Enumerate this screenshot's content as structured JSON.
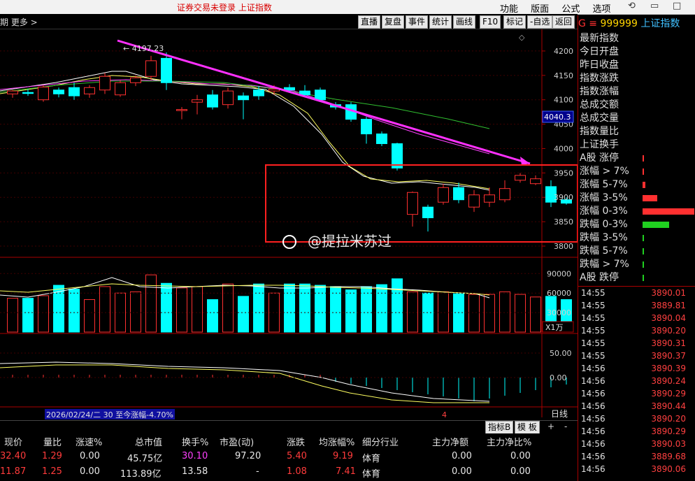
{
  "topbar": {
    "title": "证券交易未登录  上证指数",
    "menu": [
      "功能",
      "版面",
      "公式",
      "选项"
    ]
  },
  "toolbar": {
    "left": "期  更多 >",
    "buttons": [
      "直播",
      "复盘",
      "事件",
      "统计",
      "画线",
      "F10",
      "标记",
      "-自选",
      "返回"
    ]
  },
  "chart_data": {
    "type": "candlestick",
    "y_axis": [
      "4200",
      "4150",
      "4100",
      "4050",
      "4000",
      "3950",
      "3900",
      "3850",
      "3800"
    ],
    "ylim": [
      3800,
      4230
    ],
    "current_price_tag": "4040.3",
    "high_annotation": "← 4197.23",
    "date_range_label": "2026/02/24/二 30 至今涨幅-4.70%",
    "x_tick": "4",
    "vol_axis": [
      "90000",
      "60000",
      "30000"
    ],
    "vol_unit": "X1万",
    "macd_axis": [
      "50.00",
      "0.00"
    ],
    "period_label": "日线",
    "candles": [
      [
        4112,
        4118,
        4104,
        4120
      ],
      [
        4115,
        4114,
        4108,
        4122
      ],
      [
        4100,
        4126,
        4096,
        4130
      ],
      [
        4120,
        4112,
        4105,
        4125
      ],
      [
        4125,
        4108,
        4100,
        4135
      ],
      [
        4112,
        4125,
        4104,
        4130
      ],
      [
        4120,
        4148,
        4112,
        4155
      ],
      [
        4110,
        4135,
        4106,
        4140
      ],
      [
        4135,
        4145,
        4128,
        4150
      ],
      [
        4148,
        4180,
        4140,
        4190
      ],
      [
        4185,
        4135,
        4120,
        4197
      ],
      [
        4080,
        4080,
        4060,
        4085
      ],
      [
        4095,
        4100,
        4070,
        4110
      ],
      [
        4110,
        4085,
        4080,
        4120
      ],
      [
        4090,
        4118,
        4082,
        4125
      ],
      [
        4108,
        4100,
        4060,
        4115
      ],
      [
        4120,
        4108,
        4100,
        4128
      ],
      [
        4118,
        4122,
        4110,
        4130
      ],
      [
        4125,
        4120,
        4115,
        4132
      ],
      [
        4118,
        4110,
        4105,
        4130
      ],
      [
        4120,
        4100,
        4098,
        4125
      ],
      [
        4090,
        4085,
        4080,
        4095
      ],
      [
        4090,
        4060,
        4055,
        4095
      ],
      [
        4060,
        4030,
        4010,
        4065
      ],
      [
        4030,
        4010,
        4005,
        4035
      ],
      [
        4010,
        3960,
        3955,
        4012
      ],
      [
        3865,
        3910,
        3840,
        3912
      ],
      [
        3880,
        3858,
        3830,
        3885
      ],
      [
        3890,
        3920,
        3885,
        3928
      ],
      [
        3920,
        3895,
        3888,
        3930
      ],
      [
        3880,
        3905,
        3870,
        3915
      ],
      [
        3890,
        3905,
        3880,
        3920
      ],
      [
        3895,
        3918,
        3890,
        3935
      ],
      [
        3935,
        3945,
        3930,
        3950
      ],
      [
        3928,
        3938,
        3925,
        3945
      ],
      [
        3922,
        3890,
        3880,
        3935
      ],
      [
        3895,
        3888,
        3885,
        3900
      ]
    ],
    "volume": [
      52,
      52,
      56,
      72,
      66,
      50,
      70,
      60,
      62,
      88,
      75,
      68,
      70,
      50,
      74,
      55,
      74,
      60,
      74,
      74,
      72,
      70,
      65,
      70,
      73,
      82,
      62,
      60,
      62,
      59,
      58,
      58,
      62,
      58,
      54,
      55,
      50
    ]
  },
  "right_panel": {
    "code": "999999",
    "name": "上证指数",
    "prefix": "G ≡",
    "labels": [
      "最新指数",
      "今日开盘",
      "昨日收盘",
      "指数涨跌",
      "指数涨幅",
      "总成交额",
      "总成交量",
      "指数量比",
      "上证换手"
    ],
    "dist_labels": [
      "A股 涨停",
      "涨幅 > 7%",
      "涨幅 5-7%",
      "涨幅 3-5%",
      "涨幅 0-3%",
      "跌幅 0-3%",
      "跌幅 3-5%",
      "跌幅 5-7%",
      "跌幅 > 7%",
      "A股 跌停"
    ],
    "dist_values": [
      0.02,
      0.01,
      0.05,
      0.28,
      1.0,
      0.52,
      0.03,
      0.01,
      0.01,
      0.01
    ],
    "ticks": [
      {
        "t": "14:55",
        "p": "3890.01"
      },
      {
        "t": "14:55",
        "p": "3889.81"
      },
      {
        "t": "14:55",
        "p": "3890.04"
      },
      {
        "t": "14:55",
        "p": "3890.20"
      },
      {
        "t": "14:55",
        "p": "3890.31"
      },
      {
        "t": "14:55",
        "p": "3890.37"
      },
      {
        "t": "14:56",
        "p": "3890.39"
      },
      {
        "t": "14:56",
        "p": "3890.24"
      },
      {
        "t": "14:56",
        "p": "3890.29"
      },
      {
        "t": "14:56",
        "p": "3890.44"
      },
      {
        "t": "14:56",
        "p": "3890.20"
      },
      {
        "t": "14:56",
        "p": "3890.29"
      },
      {
        "t": "14:56",
        "p": "3890.03"
      },
      {
        "t": "14:56",
        "p": "3889.68"
      },
      {
        "t": "14:56",
        "p": "3890.06"
      }
    ]
  },
  "bottom": {
    "tabs": [
      "指标B",
      "模 板"
    ],
    "plus": "+",
    "minus": "-"
  },
  "table": {
    "headers": [
      "现价",
      "量比",
      "涨速%",
      "总市值",
      "换手%",
      "市盈(动)",
      "涨跌",
      "均涨幅%",
      "细分行业",
      "主力净额",
      "主力净比%"
    ],
    "rows": [
      [
        "32.40",
        "1.29",
        "0.00",
        "45.75亿",
        "30.10",
        "97.20",
        "5.40",
        "9.19",
        "体育",
        "0.00",
        "0.00"
      ],
      [
        "11.87",
        "1.25",
        "0.00",
        "113.89亿",
        "13.58",
        "-",
        "1.08",
        "7.41",
        "体育",
        "0.00",
        "0.00"
      ]
    ]
  },
  "watermark": "@提拉米苏过",
  "colors": {
    "up": "#ff3030",
    "down": "#00ffff",
    "trend": "#ff30ff",
    "box": "#ff2020"
  }
}
